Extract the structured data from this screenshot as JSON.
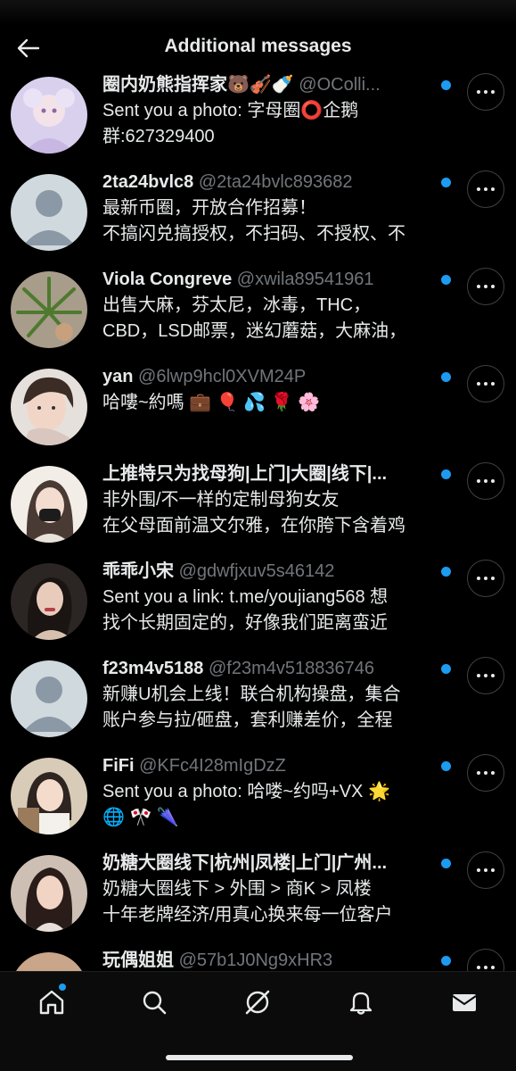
{
  "header": {
    "title": "Additional messages",
    "back_icon": "back-arrow-icon"
  },
  "colors": {
    "accent": "#1d9bf0",
    "handle": "#71767b",
    "background": "#000000"
  },
  "messages": [
    {
      "name": "圈内奶熊指挥家🐻🎻🍼",
      "handle": "@OColli...",
      "lines": [
        "Sent you a photo: 字母圈⭕企鹅",
        "群:627329400"
      ],
      "unread": true
    },
    {
      "name": "2ta24bvlc8",
      "handle": "@2ta24bvlc893682",
      "lines": [
        "最新币圈，开放合作招募！",
        "不搞闪兑搞授权，不扫码、不授权、不"
      ],
      "unread": true
    },
    {
      "name": "Viola Congreve",
      "handle": "@xwila89541961",
      "lines": [
        "出售大麻，芬太尼，冰毒，THC，",
        "CBD，LSD邮票，迷幻蘑菇，大麻油，"
      ],
      "unread": true
    },
    {
      "name": "yan",
      "handle": "@6lwp9hcl0XVM24P",
      "lines": [
        "哈嘍~約嗎 💼 🎈 💦 🌹 🌸"
      ],
      "unread": true
    },
    {
      "name": "上推特只为找母狗|上门|大圈|线下|...",
      "handle": "",
      "lines": [
        "非外围/不一样的定制母狗女友",
        "在父母面前温文尔雅，在你胯下含着鸡"
      ],
      "unread": true
    },
    {
      "name": "乖乖小宋",
      "handle": "@gdwfjxuv5s46142",
      "lines": [
        "Sent you a link: t.me/youjiang568  想",
        "找个长期固定的，好像我们距离蛮近"
      ],
      "unread": true
    },
    {
      "name": "f23m4v5188",
      "handle": "@f23m4v518836746",
      "lines": [
        "新赚U机会上线！联合机构操盘，集合",
        "账户参与拉/砸盘，套利赚差价，全程"
      ],
      "unread": true
    },
    {
      "name": "FiFi",
      "handle": "@KFc4I28mIgDzZ",
      "lines": [
        "Sent you a photo: 哈喽~约吗+VX 🌟",
        "🌐 🎌 🌂"
      ],
      "unread": true
    },
    {
      "name": "奶糖大圈线下|杭州|凤楼|上门|广州...",
      "handle": "",
      "lines": [
        "奶糖大圈线下 > 外围 > 商K > 凤楼",
        "十年老牌经济/用真心换来每一位客户"
      ],
      "unread": true
    },
    {
      "name": "玩偶姐姐",
      "handle": "@57b1J0Ng9xHR3",
      "lines": [
        ""
      ],
      "unread": true
    }
  ],
  "tabs": [
    "home-icon",
    "search-icon",
    "grok-icon",
    "notifications-icon",
    "messages-icon"
  ]
}
